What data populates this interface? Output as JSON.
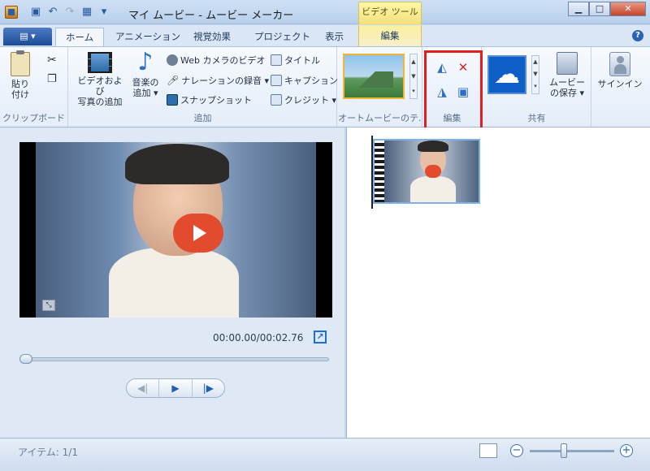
{
  "titlebar": {
    "title": "マイ ムービー - ムービー メーカー",
    "contextual_group": "ビデオ ツール",
    "minimize": "▁",
    "maximize": "□",
    "close": "✕"
  },
  "tabs": {
    "file_label": "▤ ▾",
    "items": [
      "ホーム",
      "アニメーション",
      "視覚効果",
      "プロジェクト",
      "表示"
    ],
    "contextual_tab": "編集",
    "help": "?"
  },
  "ribbon": {
    "clipboard": {
      "paste": "貼り\n付け",
      "group": "クリップボード"
    },
    "add": {
      "add_video": "ビデオおよび\n写真の追加",
      "add_music": "音楽の\n追加 ▾",
      "webcam": "Web カメラのビデオ",
      "narration": "ナレーションの録音 ▾",
      "snapshot": "スナップショット",
      "title": "タイトル",
      "caption": "キャプション",
      "credit": "クレジット ▾",
      "group": "追加"
    },
    "automovie": {
      "group": "オートムービーのテ..."
    },
    "edit": {
      "group": "編集"
    },
    "share": {
      "save_movie": "ムービー\nの保存 ▾",
      "group": "共有"
    },
    "signin": {
      "label": "サインイン"
    }
  },
  "player": {
    "timecode": "00:00.00/00:02.76"
  },
  "status": {
    "items": "アイテム: 1/1"
  },
  "colors": {
    "accent": "#1f5fb4",
    "highlight": "#e02020",
    "play": "#e34b2f"
  }
}
